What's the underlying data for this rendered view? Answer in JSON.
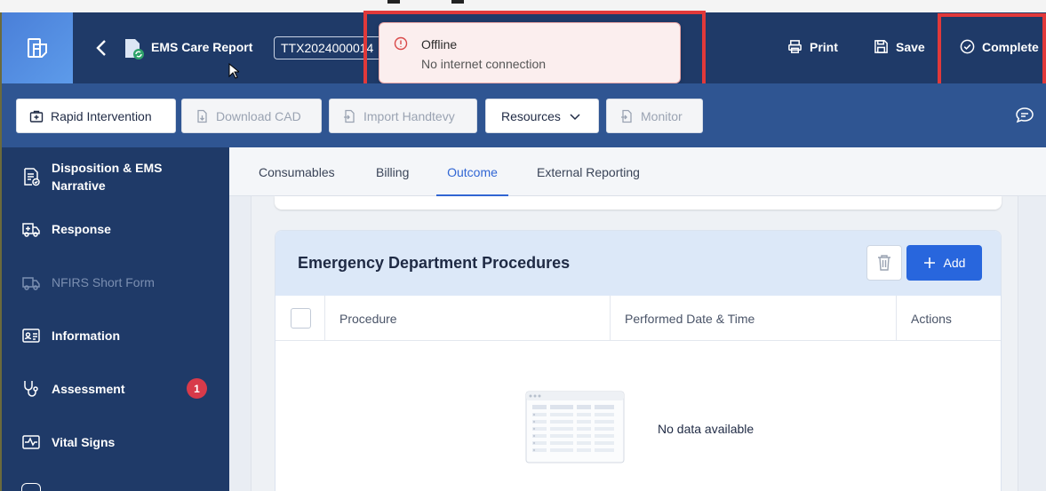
{
  "header": {
    "report_title": "EMS Care Report",
    "incident_number": "TTX2024000014",
    "print_label": "Print",
    "save_label": "Save",
    "complete_label": "Complete"
  },
  "toast": {
    "title": "Offline",
    "message": "No internet connection"
  },
  "toolbar": {
    "rapid_intervention": "Rapid Intervention",
    "download_cad": "Download CAD",
    "import_handtevy": "Import Handtevy",
    "resources": "Resources",
    "monitor": "Monitor"
  },
  "sidebar": {
    "items": [
      {
        "label": "Disposition & EMS Narrative",
        "icon": "document-check-icon"
      },
      {
        "label": "Response",
        "icon": "ambulance-icon"
      },
      {
        "label": "NFIRS Short Form",
        "icon": "fire-truck-icon"
      },
      {
        "label": "Information",
        "icon": "id-card-icon"
      },
      {
        "label": "Assessment",
        "icon": "stethoscope-icon",
        "badge": "1"
      },
      {
        "label": "Vital Signs",
        "icon": "heartbeat-icon"
      }
    ]
  },
  "tabs": [
    "Consumables",
    "Billing",
    "Outcome",
    "External Reporting"
  ],
  "active_tab": "Outcome",
  "panel": {
    "title": "Emergency Department Procedures",
    "add_label": "Add",
    "columns": [
      "Procedure",
      "Performed Date & Time",
      "Actions"
    ],
    "empty_text": "No data available"
  },
  "colors": {
    "header_bg": "#1f3a68",
    "toolbar_bg": "#2f5592",
    "accent": "#2866dd",
    "highlight": "#e1393a",
    "badge": "#d83a4a"
  }
}
